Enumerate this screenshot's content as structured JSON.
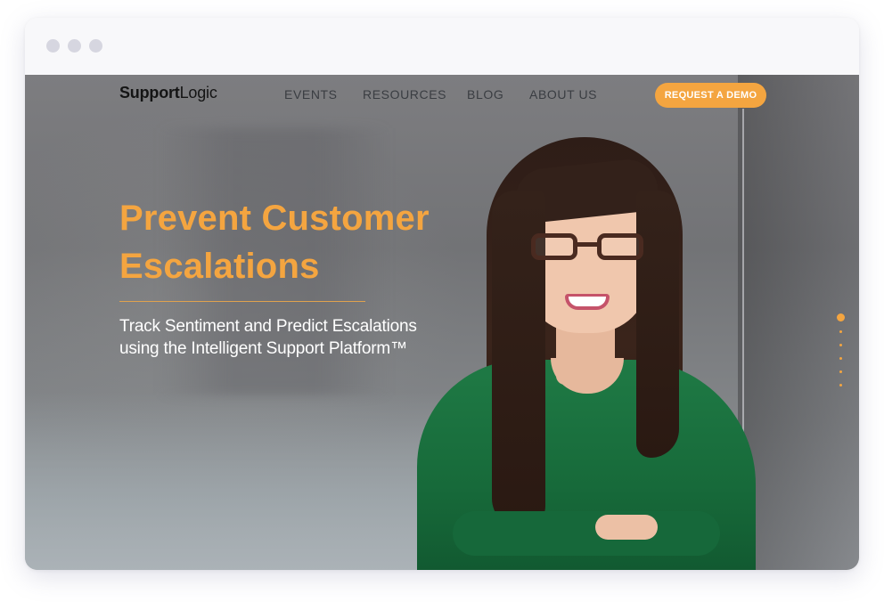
{
  "window": {
    "controls": [
      "close-dot",
      "minimize-dot",
      "maximize-dot"
    ]
  },
  "brand": {
    "name_bold": "Support",
    "name_light": "Logic",
    "accent_color": "#f4a540"
  },
  "nav": {
    "items": [
      {
        "label": "EVENTS"
      },
      {
        "label": "RESOURCES"
      },
      {
        "label": "BLOG"
      },
      {
        "label": "ABOUT US"
      }
    ],
    "cta_label": "REQUEST A DEMO"
  },
  "hero": {
    "headline_line1": "Prevent Customer",
    "headline_line2": "Escalations",
    "subhead_line1": "Track Sentiment and Predict Escalations",
    "subhead_line2": "using the Intelligent Support Platform™",
    "slides": {
      "count": 6,
      "active_index": 0
    }
  }
}
